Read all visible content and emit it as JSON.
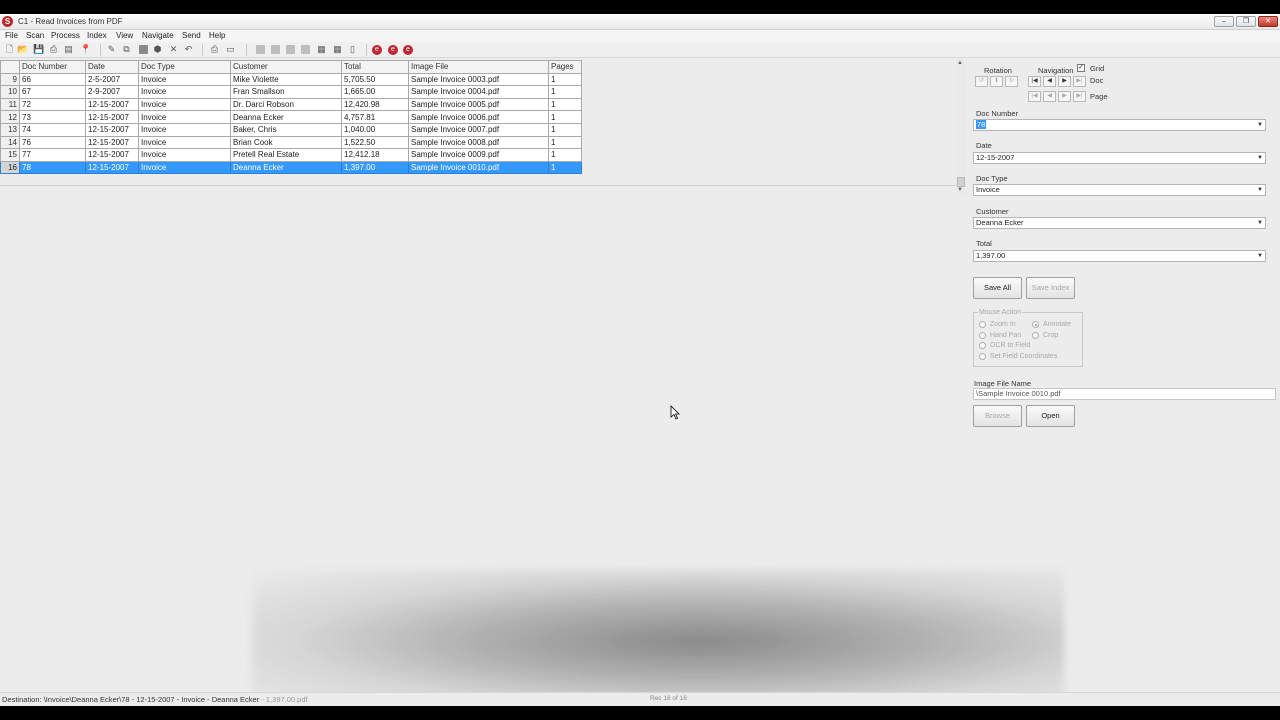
{
  "window": {
    "title": "C1 - Read Invoices from PDF"
  },
  "menu": [
    "File",
    "Scan",
    "Process",
    "Index",
    "View",
    "Navigate",
    "Send",
    "Help"
  ],
  "grid": {
    "columns": [
      "Doc Number",
      "Date",
      "Doc Type",
      "Customer",
      "Total",
      "Image File",
      "Pages"
    ],
    "rows": [
      {
        "row": "9",
        "cells": [
          "66",
          "2-5-2007",
          "Invoice",
          "Mike Violette",
          "5,705.50",
          "Sample Invoice 0003.pdf",
          "1"
        ]
      },
      {
        "row": "10",
        "cells": [
          "67",
          "2-9-2007",
          "Invoice",
          "Fran Smallson",
          "1,665.00",
          "Sample Invoice 0004.pdf",
          "1"
        ]
      },
      {
        "row": "11",
        "cells": [
          "72",
          "12-15-2007",
          "Invoice",
          "Dr. Darci Robson",
          "12,420.98",
          "Sample Invoice 0005.pdf",
          "1"
        ]
      },
      {
        "row": "12",
        "cells": [
          "73",
          "12-15-2007",
          "Invoice",
          "Deanna Ecker",
          "4,757.81",
          "Sample Invoice 0006.pdf",
          "1"
        ]
      },
      {
        "row": "13",
        "cells": [
          "74",
          "12-15-2007",
          "Invoice",
          "Baker, Chris",
          "1,040.00",
          "Sample Invoice 0007.pdf",
          "1"
        ]
      },
      {
        "row": "14",
        "cells": [
          "76",
          "12-15-2007",
          "Invoice",
          "Brian Cook",
          "1,522.50",
          "Sample Invoice 0008.pdf",
          "1"
        ]
      },
      {
        "row": "15",
        "cells": [
          "77",
          "12-15-2007",
          "Invoice",
          "Pretell Real Estate",
          "12,412.18",
          "Sample Invoice 0009.pdf",
          "1"
        ]
      },
      {
        "row": "16",
        "cells": [
          "78",
          "12-15-2007",
          "Invoice",
          "Deanna Ecker",
          "1,397.00",
          "Sample Invoice 0010.pdf",
          "1"
        ]
      }
    ],
    "selected_row_index": 7
  },
  "panel": {
    "rotation_label": "Rotation",
    "navigation_label": "Navigation",
    "grid_label": "Grid",
    "grid_checked": "✓",
    "doc_label": "Doc",
    "page_label": "Page",
    "fields": [
      {
        "label": "Doc Number",
        "value": "78"
      },
      {
        "label": "Date",
        "value": "12-15-2007"
      },
      {
        "label": "Doc Type",
        "value": "Invoice"
      },
      {
        "label": "Customer",
        "value": "Deanna Ecker"
      },
      {
        "label": "Total",
        "value": "1,397.00"
      }
    ],
    "save_all": "Save All",
    "save_index": "Save Index",
    "mouse_action": {
      "title": "Mouse Action",
      "options": [
        "Zoom In",
        "Annotate",
        "Hand Pan",
        "Crop",
        "OCR to Field",
        "Set Field Coordinates"
      ],
      "selected": "Annotate"
    },
    "image_file_label": "Image File Name",
    "image_file_value": "\\Sample Invoice 0010.pdf",
    "browse": "Browse",
    "open": "Open"
  },
  "status": {
    "destination": "Destination: \\Invoice\\Deanna Ecker\\78 - 12-15-2007 - Invoice - Deanna Ecker",
    "destination_tail": " - 1,397.00.pdf",
    "record": "Rec 16 of 16"
  }
}
